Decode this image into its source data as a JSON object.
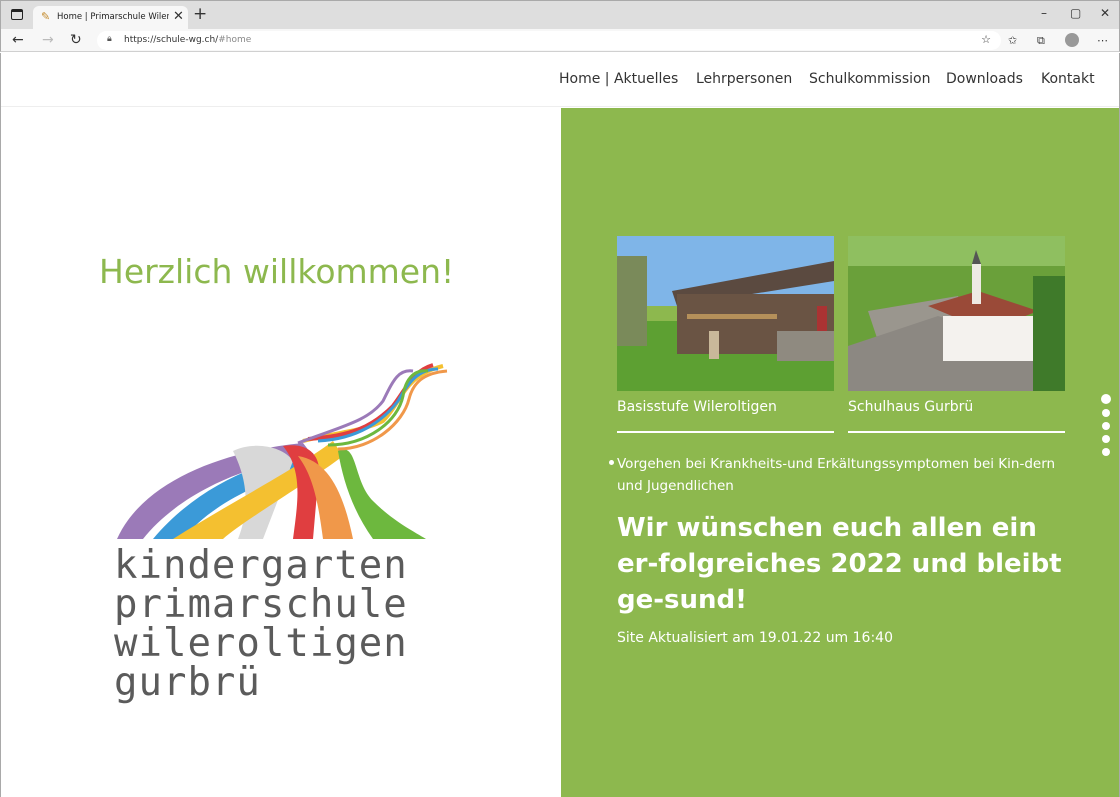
{
  "browser": {
    "tab_title": "Home | Primarschule Wileroltigen",
    "url_host": "https://schule-wg.ch/",
    "url_path": "#home",
    "tab_close": "✕",
    "new_tab": "+"
  },
  "nav": {
    "items": [
      "Home | Aktuelles",
      "Lehrpersonen",
      "Schulkommission",
      "Downloads",
      "Kontakt"
    ]
  },
  "hero": {
    "welcome": "Herzlich willkommen!",
    "logo_lines": [
      "kindergarten",
      "primarschule",
      "wileroltigen",
      "gurbrü"
    ]
  },
  "cards": [
    {
      "caption": "Basisstufe Wileroltigen"
    },
    {
      "caption": "Schulhaus Gurbrü"
    }
  ],
  "news": {
    "bullet": "Vorgehen bei Krankheits-und Erkältungssymptomen bei Kin-dern und Jugendlichen",
    "wish": "Wir wünschen euch allen ein er-folgreiches 2022 und bleibt ge-sund!",
    "updated": "Site Aktualisiert am 19.01.22 um 16:40"
  },
  "colors": {
    "accent": "#8db84e",
    "logo_text": "#5b5b5b"
  }
}
